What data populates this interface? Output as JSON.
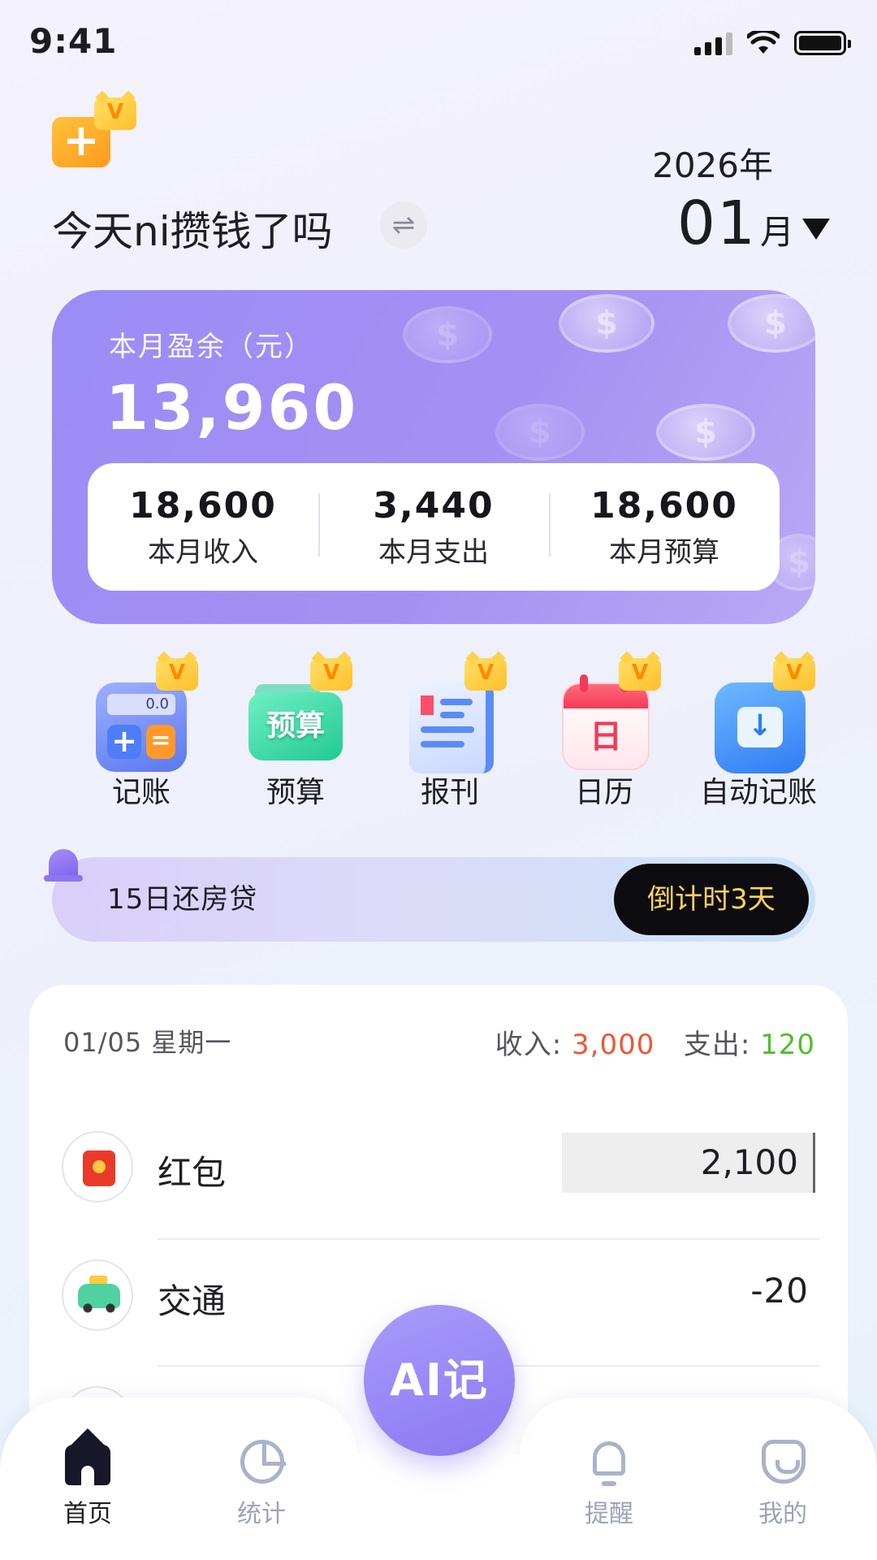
{
  "status_bar": {
    "time": "9:41"
  },
  "header": {
    "logo_vip": "V",
    "title": "今天ni攒钱了吗",
    "switch_icon": "⇌",
    "year": "2026年",
    "month": "01",
    "month_unit": "月"
  },
  "summary": {
    "balance_label": "本月盈余（元）",
    "balance_value": "13,960",
    "coin_symbol": "$",
    "stats": [
      {
        "value": "18,600",
        "label": "本月收入"
      },
      {
        "value": "3,440",
        "label": "本月支出"
      },
      {
        "value": "18,600",
        "label": "本月预算"
      }
    ]
  },
  "quick_actions": [
    {
      "label": "记账",
      "vip": "V",
      "icon": "calculator-icon",
      "screen": "0.0",
      "plus": "+",
      "eq": "="
    },
    {
      "label": "预算",
      "vip": "V",
      "icon": "budget-icon",
      "text": "预算"
    },
    {
      "label": "报刊",
      "vip": "V",
      "icon": "newspaper-icon"
    },
    {
      "label": "日历",
      "vip": "V",
      "icon": "calendar-icon",
      "text": "日"
    },
    {
      "label": "自动记账",
      "vip": "V",
      "icon": "auto-record-icon",
      "arrow": "↓"
    }
  ],
  "reminder": {
    "text": "15日还房贷",
    "countdown": "倒计时3天"
  },
  "transactions": {
    "date": "01/05  星期一",
    "income_label": "收入: ",
    "income_value": "3,000",
    "expense_label": "支出: ",
    "expense_value": "120",
    "items": [
      {
        "name": "红包",
        "amount": "2,100",
        "icon": "red-packet-icon"
      },
      {
        "name": "交通",
        "amount": "-20",
        "icon": "taxi-icon"
      }
    ]
  },
  "ai_button": "AI记",
  "nav": [
    {
      "label": "首页",
      "icon": "home-icon",
      "active": true
    },
    {
      "label": "统计",
      "icon": "stats-icon"
    },
    {
      "label": "提醒",
      "icon": "bell-icon"
    },
    {
      "label": "我的",
      "icon": "profile-icon"
    }
  ],
  "colors": {
    "accent": "#9b8cf5",
    "income": "#f25432",
    "expense": "#4fbf2c",
    "countdown_text": "#ffd25a"
  }
}
